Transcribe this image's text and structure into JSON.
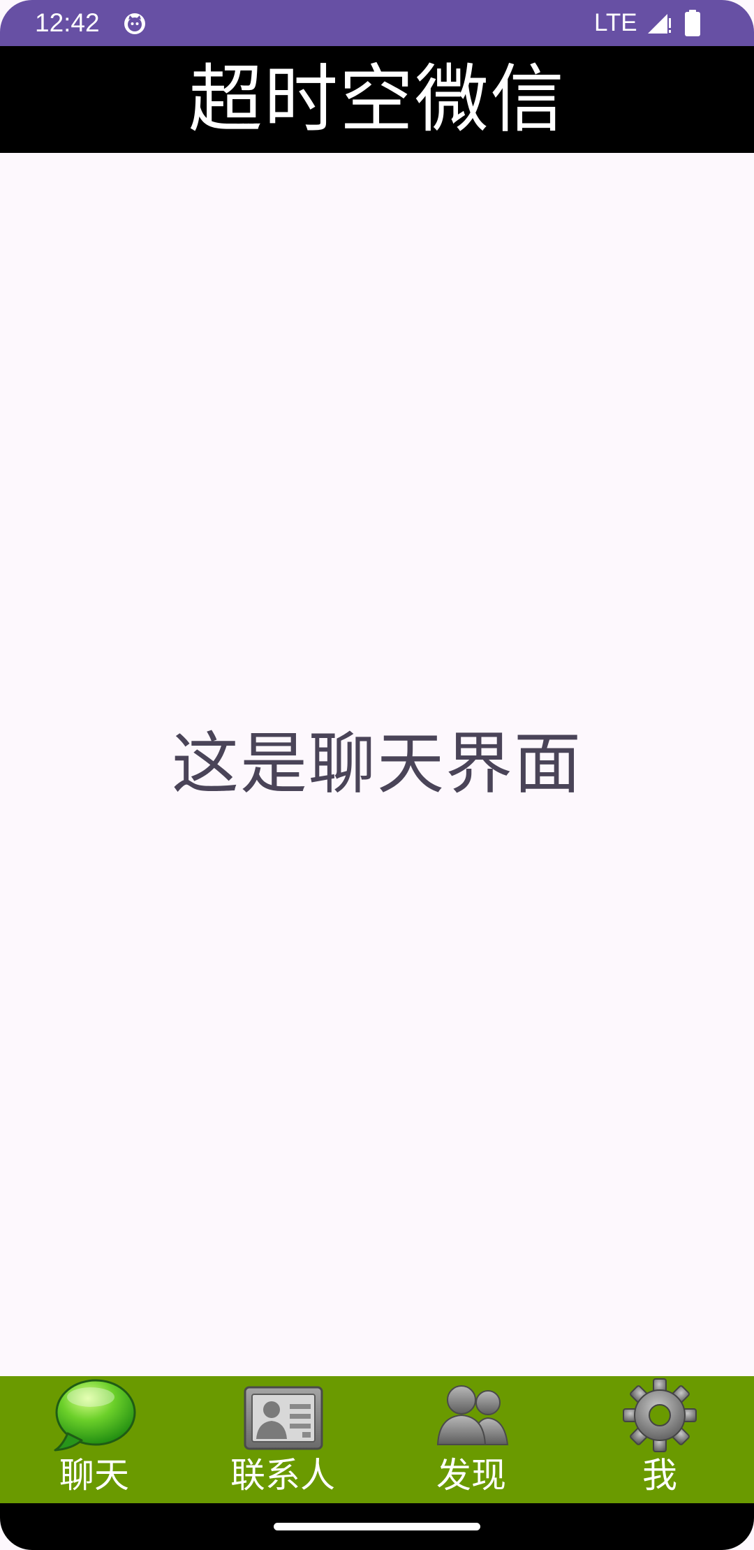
{
  "status_bar": {
    "time": "12:42",
    "network": "LTE",
    "app_icon": "android-cat-icon",
    "signal_icon": "signal-icon",
    "battery_icon": "battery-icon",
    "color": "#6750a4"
  },
  "title_bar": {
    "title": "超时空微信",
    "background": "#000000"
  },
  "content": {
    "message": "这是聊天界面"
  },
  "bottom_nav": {
    "background": "#6a9a00",
    "items": [
      {
        "label": "聊天",
        "icon": "chat-bubble-icon",
        "selected": true
      },
      {
        "label": "联系人",
        "icon": "contact-card-icon",
        "selected": false
      },
      {
        "label": "发现",
        "icon": "people-icon",
        "selected": false
      },
      {
        "label": "我",
        "icon": "gear-icon",
        "selected": false
      }
    ]
  }
}
